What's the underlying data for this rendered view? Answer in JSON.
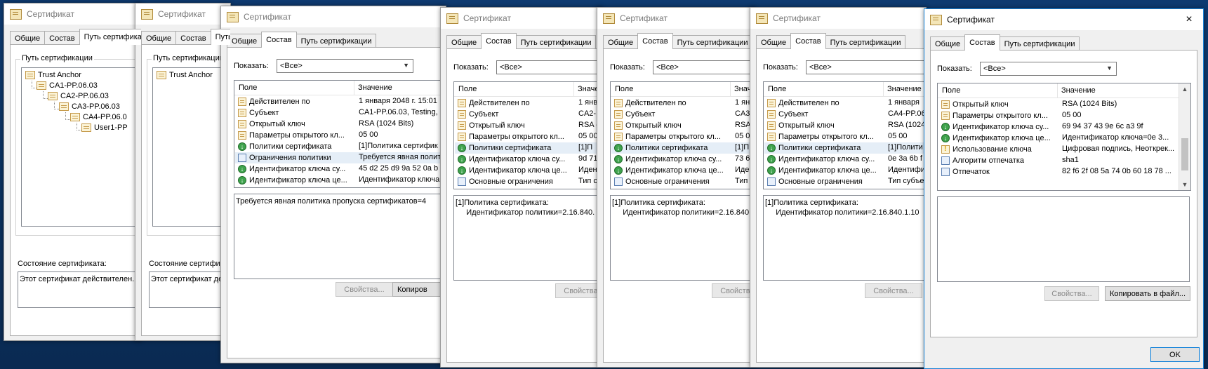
{
  "title": "Сертификат",
  "tabs": {
    "general": "Общие",
    "details": "Состав",
    "path": "Путь сертификации"
  },
  "path": {
    "group_label": "Путь сертификации",
    "nodes": [
      "Trust Anchor",
      "CA1-PP.06.03",
      "CA2-PP.06.03",
      "CA3-PP.06.03",
      "CA4-PP.06.0",
      "User1-PP"
    ],
    "status_label": "Состояние сертификата:",
    "status_text": "Этот сертификат действителен."
  },
  "details": {
    "show_label": "Показать:",
    "show_value": "<Все>",
    "col_field": "Поле",
    "col_value": "Значение",
    "btn_properties": "Свойства...",
    "btn_copy": "Копировать в файл...",
    "btn_copy_short": "Копиров"
  },
  "w3": {
    "rows": [
      {
        "f": "Действителен по",
        "v": "1 января 2048 г. 15:01",
        "icon": "doc"
      },
      {
        "f": "Субъект",
        "v": "CA1-PP.06.03, Testing,",
        "icon": "doc"
      },
      {
        "f": "Открытый ключ",
        "v": "RSA (1024 Bits)",
        "icon": "doc"
      },
      {
        "f": "Параметры открытого кл...",
        "v": "05 00",
        "icon": "doc"
      },
      {
        "f": "Политики сертификата",
        "v": "[1]Политика сертифик",
        "icon": "pol"
      },
      {
        "f": "Ограничения политики",
        "v": "Требуется явная полит",
        "icon": "blue"
      },
      {
        "f": "Идентификатор ключа су...",
        "v": "45 d2 25 d9 9a 52 0a b",
        "icon": "pol"
      },
      {
        "f": "Идентификатор ключа це...",
        "v": "Идентификатор ключа",
        "icon": "pol"
      }
    ],
    "text": "Требуется явная политика пропуска сертификатов=4"
  },
  "w4": {
    "rows": [
      {
        "f": "Действителен по",
        "v": "1 янв",
        "icon": "doc"
      },
      {
        "f": "Субъект",
        "v": "CA2-",
        "icon": "doc"
      },
      {
        "f": "Открытый ключ",
        "v": "RSA (",
        "icon": "doc"
      },
      {
        "f": "Параметры открытого кл...",
        "v": "05 00",
        "icon": "doc"
      },
      {
        "f": "Политики сертификата",
        "v": "[1]П",
        "icon": "pol"
      },
      {
        "f": "Идентификатор ключа су...",
        "v": "9d 71",
        "icon": "pol"
      },
      {
        "f": "Идентификатор ключа це...",
        "v": "Иден",
        "icon": "pol"
      },
      {
        "f": "Основные ограничения",
        "v": "Тип с",
        "icon": "blue"
      }
    ],
    "text": "[1]Политика сертификата:\n     Идентификатор политики=2.16.840."
  },
  "w5": {
    "rows": [
      {
        "f": "Действителен по",
        "v": "1 ян",
        "icon": "doc"
      },
      {
        "f": "Субъект",
        "v": "CA3",
        "icon": "doc"
      },
      {
        "f": "Открытый ключ",
        "v": "RSA",
        "icon": "doc"
      },
      {
        "f": "Параметры открытого кл...",
        "v": "05 0",
        "icon": "doc"
      },
      {
        "f": "Политики сертификата",
        "v": "[1]П",
        "icon": "pol"
      },
      {
        "f": "Идентификатор ключа су...",
        "v": "73 6",
        "icon": "pol"
      },
      {
        "f": "Идентификатор ключа це...",
        "v": "Иден",
        "icon": "pol"
      },
      {
        "f": "Основные ограничения",
        "v": "Тип",
        "icon": "blue"
      }
    ],
    "text": "[1]Политика сертификата:\n     Идентификатор политики=2.16.840"
  },
  "w6": {
    "rows": [
      {
        "f": "Действителен по",
        "v": "1 января",
        "icon": "doc"
      },
      {
        "f": "Субъект",
        "v": "CA4-PP.06",
        "icon": "doc"
      },
      {
        "f": "Открытый ключ",
        "v": "RSA (1024",
        "icon": "doc"
      },
      {
        "f": "Параметры открытого кл...",
        "v": "05 00",
        "icon": "doc"
      },
      {
        "f": "Политики сертификата",
        "v": "[1]Полити",
        "icon": "pol"
      },
      {
        "f": "Идентификатор ключа су...",
        "v": "0e 3a 6b f",
        "icon": "pol"
      },
      {
        "f": "Идентификатор ключа це...",
        "v": "Идентифи",
        "icon": "pol"
      },
      {
        "f": "Основные ограничения",
        "v": "Тип субъе",
        "icon": "blue"
      }
    ],
    "text": "[1]Политика сертификата:\n     Идентификатор политики=2.16.840.1.10"
  },
  "w7": {
    "rows": [
      {
        "f": "Открытый ключ",
        "v": "RSA (1024 Bits)",
        "icon": "doc"
      },
      {
        "f": "Параметры открытого кл...",
        "v": "05 00",
        "icon": "doc"
      },
      {
        "f": "Идентификатор ключа су...",
        "v": "69 94 37 43 9e 6c a3 9f",
        "icon": "pol"
      },
      {
        "f": "Идентификатор ключа це...",
        "v": "Идентификатор ключа=0e 3...",
        "icon": "pol"
      },
      {
        "f": "Использование ключа",
        "v": "Цифровая подпись, Неоткрек...",
        "icon": "warn"
      },
      {
        "f": "Алгоритм отпечатка",
        "v": "sha1",
        "icon": "blue"
      },
      {
        "f": "Отпечаток",
        "v": "82 f6 2f 08 5a 74 0b 60 18 78 ...",
        "icon": "blue"
      }
    ],
    "text": "",
    "ok": "OK",
    "close_icon": "×",
    "scroll_up": "▲",
    "scroll_down": "▼"
  },
  "colors": {
    "desktop": "#0b2f5c",
    "window_bg": "#f0f0f0",
    "active_border": "#1883d7"
  }
}
